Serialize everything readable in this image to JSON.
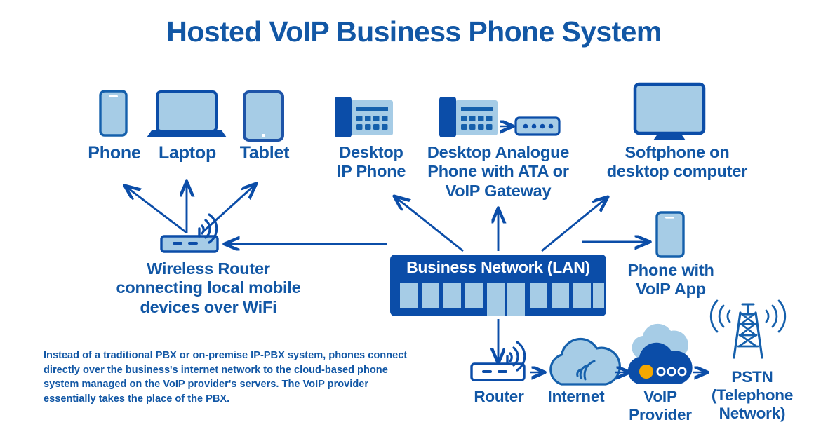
{
  "title": "Hosted VoIP Business Phone System",
  "colors": {
    "dark_blue": "#0b4da8",
    "label_blue": "#1257a5",
    "light_blue": "#a6cce6",
    "mid_blue": "#1560ac",
    "accent_orange": "#f5a800",
    "white": "#ffffff"
  },
  "devices": {
    "phone": {
      "label": "Phone",
      "icon": "smartphone-icon"
    },
    "laptop": {
      "label": "Laptop",
      "icon": "laptop-icon"
    },
    "tablet": {
      "label": "Tablet",
      "icon": "tablet-icon"
    },
    "desk_ip_phone": {
      "label": "Desktop\nIP Phone",
      "icon": "desk-phone-icon"
    },
    "analogue_phone": {
      "label": "Desktop Analogue\nPhone with ATA or\nVoIP Gateway",
      "icon": "desk-phone-icon",
      "secondary_icon": "ata-box-icon"
    },
    "softphone": {
      "label": "Softphone on\ndesktop computer",
      "icon": "desktop-monitor-icon"
    },
    "wireless_router": {
      "label": "Wireless Router\nconnecting local mobile\ndevices over WiFi",
      "icon": "wireless-router-icon"
    },
    "voip_app_phone": {
      "label": "Phone with\nVoIP App",
      "icon": "smartphone-icon"
    },
    "router": {
      "label": "Router",
      "icon": "router-icon"
    },
    "internet": {
      "label": "Internet",
      "icon": "cloud-wifi-icon"
    },
    "voip_provider": {
      "label": "VoIP\nProvider",
      "icon": "cloud-server-icon"
    },
    "pstn": {
      "label": "PSTN\n(Telephone\nNetwork)",
      "icon": "cell-tower-icon"
    }
  },
  "lan": {
    "label": "Business Network (LAN)",
    "port_count": 10
  },
  "footnote": "Instead of a traditional PBX or on-premise IP-PBX system, phones connect directly over the business's internet network to the cloud-based phone system managed on the VoIP provider's servers. The VoIP provider essentially takes the place of the PBX."
}
